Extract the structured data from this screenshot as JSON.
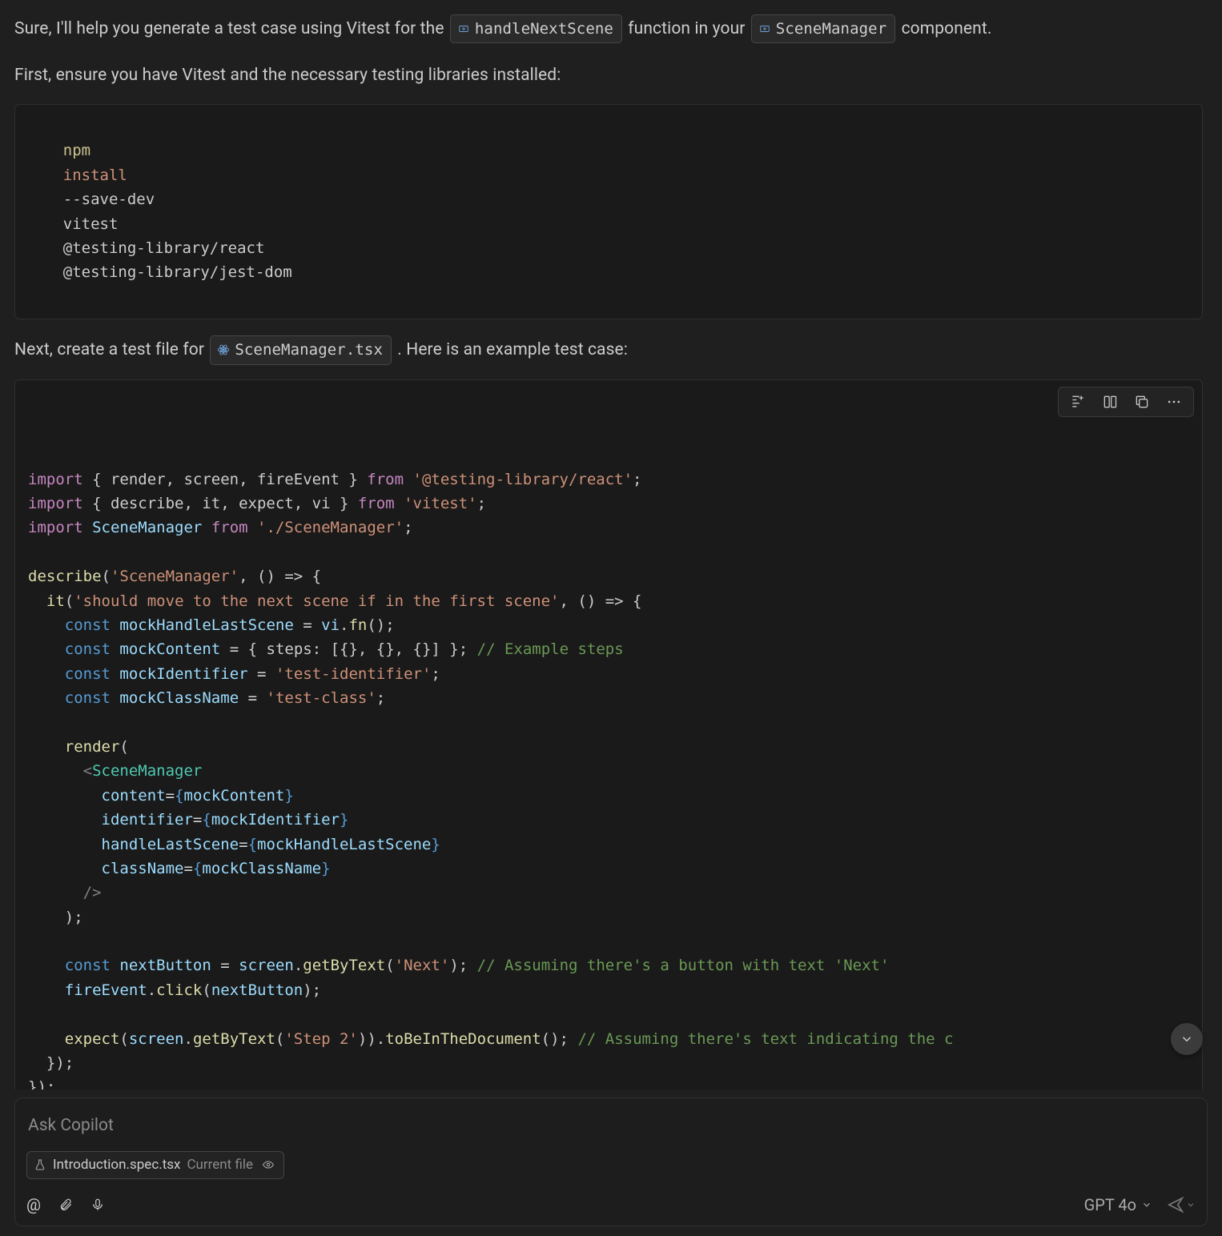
{
  "message": {
    "intro_1a": "Sure, I'll help you generate a test case using Vitest for the ",
    "pill_fn": "handleNextScene",
    "intro_1b": " function in your ",
    "pill_comp": "SceneManager",
    "intro_1c": " component.",
    "intro_2": "First, ensure you have Vitest and the necessary testing libraries installed:",
    "install_cmd_tokens": [
      "npm",
      "install",
      "--save-dev",
      "vitest",
      "@testing-library/react",
      "@testing-library/jest-dom"
    ],
    "intro_3a": "Next, create a test file for ",
    "pill_file": "SceneManager.tsx",
    "intro_3b": ". Here is an example test case:",
    "code": {
      "l1": {
        "kw": "import",
        "b": "{ render, screen, fireEvent }",
        "from": "from",
        "str": "'@testing-library/react'"
      },
      "l2": {
        "kw": "import",
        "b": "{ describe, it, expect, vi }",
        "from": "from",
        "str": "'vitest'"
      },
      "l3": {
        "kw": "import",
        "id": "SceneManager",
        "from": "from",
        "str": "'./SceneManager'"
      },
      "l4": {
        "fn": "describe",
        "str": "'SceneManager'",
        "arrow": "() => {"
      },
      "l5": {
        "fn": "it",
        "str": "'should move to the next scene if in the first scene'",
        "arrow": "() => {"
      },
      "l6": {
        "kw": "const",
        "id": "mockHandleLastScene",
        "rhs_obj": "vi",
        "rhs_fn": "fn"
      },
      "l7": {
        "kw": "const",
        "id": "mockContent",
        "rhs": "{ steps: [{}, {}, {}] };",
        "comment": "// Example steps"
      },
      "l8": {
        "kw": "const",
        "id": "mockIdentifier",
        "str": "'test-identifier'"
      },
      "l9": {
        "kw": "const",
        "id": "mockClassName",
        "str": "'test-class'"
      },
      "l10": {
        "fn": "render"
      },
      "l11": {
        "tag": "SceneManager"
      },
      "l12": {
        "attr": "content",
        "val": "mockContent"
      },
      "l13": {
        "attr": "identifier",
        "val": "mockIdentifier"
      },
      "l14": {
        "attr": "handleLastScene",
        "val": "mockHandleLastScene"
      },
      "l15": {
        "attr": "className",
        "val": "mockClassName"
      },
      "l16": {
        "kw": "const",
        "id": "nextButton",
        "obj": "screen",
        "fn": "getByText",
        "str": "'Next'",
        "comment": "// Assuming there's a button with text 'Next'"
      },
      "l17": {
        "obj": "fireEvent",
        "fn": "click",
        "arg": "nextButton"
      },
      "l18": {
        "fn1": "expect",
        "obj": "screen",
        "fn2": "getByText",
        "str": "'Step 2'",
        "fn3": "toBeInTheDocument",
        "comment": "// Assuming there's text indicating the c"
      }
    }
  },
  "toolbar": {
    "insert_label": "Insert at cursor",
    "insert_file_label": "Insert into new file",
    "copy_label": "Copy",
    "more_label": "More actions"
  },
  "input": {
    "placeholder": "Ask Copilot",
    "context_file": "Introduction.spec.tsx",
    "context_suffix": "Current file",
    "model": "GPT 4o",
    "scroll_label": "Scroll to bottom"
  }
}
